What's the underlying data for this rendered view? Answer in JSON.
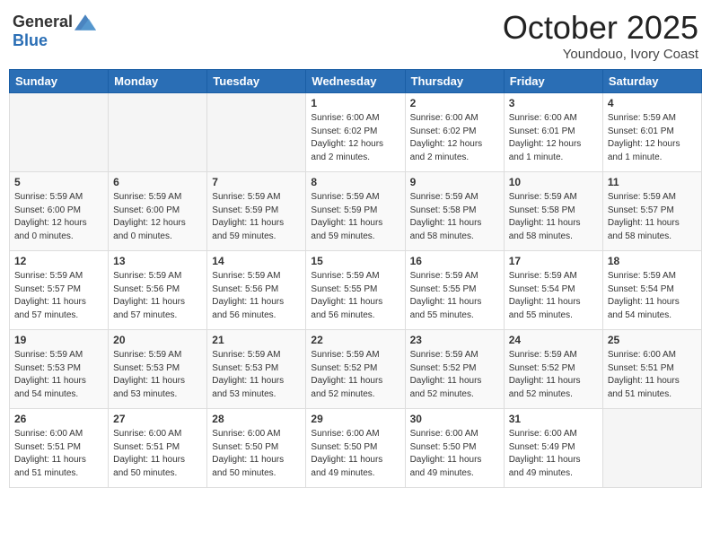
{
  "header": {
    "logo_general": "General",
    "logo_blue": "Blue",
    "month": "October 2025",
    "location": "Youndouo, Ivory Coast"
  },
  "weekdays": [
    "Sunday",
    "Monday",
    "Tuesday",
    "Wednesday",
    "Thursday",
    "Friday",
    "Saturday"
  ],
  "weeks": [
    [
      {
        "day": "",
        "info": ""
      },
      {
        "day": "",
        "info": ""
      },
      {
        "day": "",
        "info": ""
      },
      {
        "day": "1",
        "info": "Sunrise: 6:00 AM\nSunset: 6:02 PM\nDaylight: 12 hours\nand 2 minutes."
      },
      {
        "day": "2",
        "info": "Sunrise: 6:00 AM\nSunset: 6:02 PM\nDaylight: 12 hours\nand 2 minutes."
      },
      {
        "day": "3",
        "info": "Sunrise: 6:00 AM\nSunset: 6:01 PM\nDaylight: 12 hours\nand 1 minute."
      },
      {
        "day": "4",
        "info": "Sunrise: 5:59 AM\nSunset: 6:01 PM\nDaylight: 12 hours\nand 1 minute."
      }
    ],
    [
      {
        "day": "5",
        "info": "Sunrise: 5:59 AM\nSunset: 6:00 PM\nDaylight: 12 hours\nand 0 minutes."
      },
      {
        "day": "6",
        "info": "Sunrise: 5:59 AM\nSunset: 6:00 PM\nDaylight: 12 hours\nand 0 minutes."
      },
      {
        "day": "7",
        "info": "Sunrise: 5:59 AM\nSunset: 5:59 PM\nDaylight: 11 hours\nand 59 minutes."
      },
      {
        "day": "8",
        "info": "Sunrise: 5:59 AM\nSunset: 5:59 PM\nDaylight: 11 hours\nand 59 minutes."
      },
      {
        "day": "9",
        "info": "Sunrise: 5:59 AM\nSunset: 5:58 PM\nDaylight: 11 hours\nand 58 minutes."
      },
      {
        "day": "10",
        "info": "Sunrise: 5:59 AM\nSunset: 5:58 PM\nDaylight: 11 hours\nand 58 minutes."
      },
      {
        "day": "11",
        "info": "Sunrise: 5:59 AM\nSunset: 5:57 PM\nDaylight: 11 hours\nand 58 minutes."
      }
    ],
    [
      {
        "day": "12",
        "info": "Sunrise: 5:59 AM\nSunset: 5:57 PM\nDaylight: 11 hours\nand 57 minutes."
      },
      {
        "day": "13",
        "info": "Sunrise: 5:59 AM\nSunset: 5:56 PM\nDaylight: 11 hours\nand 57 minutes."
      },
      {
        "day": "14",
        "info": "Sunrise: 5:59 AM\nSunset: 5:56 PM\nDaylight: 11 hours\nand 56 minutes."
      },
      {
        "day": "15",
        "info": "Sunrise: 5:59 AM\nSunset: 5:55 PM\nDaylight: 11 hours\nand 56 minutes."
      },
      {
        "day": "16",
        "info": "Sunrise: 5:59 AM\nSunset: 5:55 PM\nDaylight: 11 hours\nand 55 minutes."
      },
      {
        "day": "17",
        "info": "Sunrise: 5:59 AM\nSunset: 5:54 PM\nDaylight: 11 hours\nand 55 minutes."
      },
      {
        "day": "18",
        "info": "Sunrise: 5:59 AM\nSunset: 5:54 PM\nDaylight: 11 hours\nand 54 minutes."
      }
    ],
    [
      {
        "day": "19",
        "info": "Sunrise: 5:59 AM\nSunset: 5:53 PM\nDaylight: 11 hours\nand 54 minutes."
      },
      {
        "day": "20",
        "info": "Sunrise: 5:59 AM\nSunset: 5:53 PM\nDaylight: 11 hours\nand 53 minutes."
      },
      {
        "day": "21",
        "info": "Sunrise: 5:59 AM\nSunset: 5:53 PM\nDaylight: 11 hours\nand 53 minutes."
      },
      {
        "day": "22",
        "info": "Sunrise: 5:59 AM\nSunset: 5:52 PM\nDaylight: 11 hours\nand 52 minutes."
      },
      {
        "day": "23",
        "info": "Sunrise: 5:59 AM\nSunset: 5:52 PM\nDaylight: 11 hours\nand 52 minutes."
      },
      {
        "day": "24",
        "info": "Sunrise: 5:59 AM\nSunset: 5:52 PM\nDaylight: 11 hours\nand 52 minutes."
      },
      {
        "day": "25",
        "info": "Sunrise: 6:00 AM\nSunset: 5:51 PM\nDaylight: 11 hours\nand 51 minutes."
      }
    ],
    [
      {
        "day": "26",
        "info": "Sunrise: 6:00 AM\nSunset: 5:51 PM\nDaylight: 11 hours\nand 51 minutes."
      },
      {
        "day": "27",
        "info": "Sunrise: 6:00 AM\nSunset: 5:51 PM\nDaylight: 11 hours\nand 50 minutes."
      },
      {
        "day": "28",
        "info": "Sunrise: 6:00 AM\nSunset: 5:50 PM\nDaylight: 11 hours\nand 50 minutes."
      },
      {
        "day": "29",
        "info": "Sunrise: 6:00 AM\nSunset: 5:50 PM\nDaylight: 11 hours\nand 49 minutes."
      },
      {
        "day": "30",
        "info": "Sunrise: 6:00 AM\nSunset: 5:50 PM\nDaylight: 11 hours\nand 49 minutes."
      },
      {
        "day": "31",
        "info": "Sunrise: 6:00 AM\nSunset: 5:49 PM\nDaylight: 11 hours\nand 49 minutes."
      },
      {
        "day": "",
        "info": ""
      }
    ]
  ]
}
